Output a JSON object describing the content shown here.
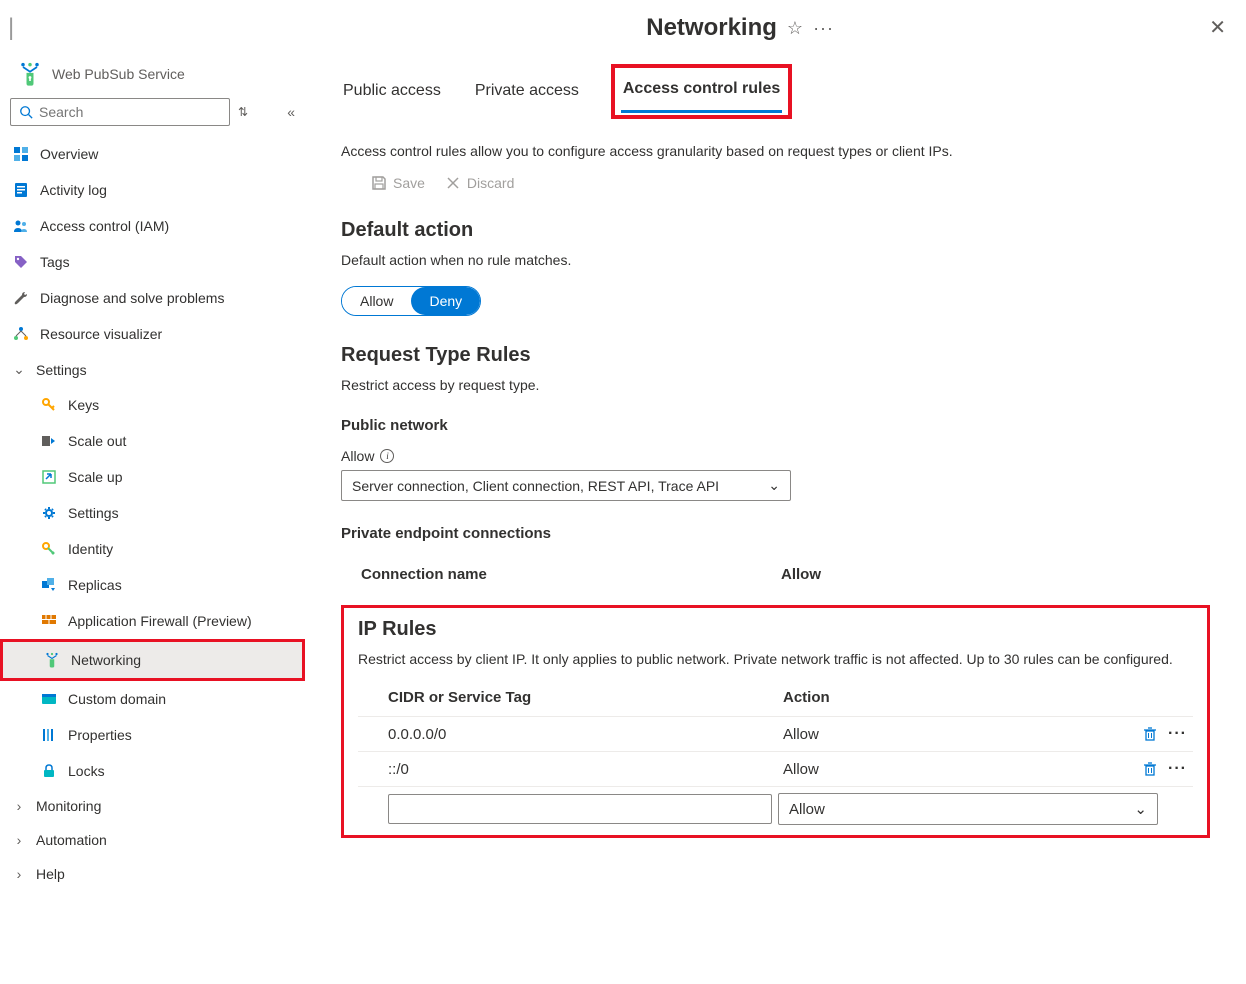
{
  "header": {
    "title": "Networking",
    "separator": "|"
  },
  "sidebar": {
    "service_name": "Web PubSub Service",
    "search_placeholder": "Search",
    "items": {
      "overview": "Overview",
      "activity": "Activity log",
      "iam": "Access control (IAM)",
      "tags": "Tags",
      "diagnose": "Diagnose and solve problems",
      "visualizer": "Resource visualizer",
      "settings": "Settings",
      "keys": "Keys",
      "scaleout": "Scale out",
      "scaleup": "Scale up",
      "settings_sub": "Settings",
      "identity": "Identity",
      "replicas": "Replicas",
      "firewall": "Application Firewall (Preview)",
      "networking": "Networking",
      "domain": "Custom domain",
      "properties": "Properties",
      "locks": "Locks",
      "monitoring": "Monitoring",
      "automation": "Automation",
      "help": "Help"
    }
  },
  "tabs": {
    "public": "Public access",
    "private": "Private access",
    "acr": "Access control rules"
  },
  "main": {
    "desc": "Access control rules allow you to configure access granularity based on request types or client IPs.",
    "save": "Save",
    "discard": "Discard",
    "default_action": {
      "heading": "Default action",
      "desc": "Default action when no rule matches.",
      "allow": "Allow",
      "deny": "Deny"
    },
    "request_rules": {
      "heading": "Request Type Rules",
      "desc": "Restrict access by request type.",
      "public_label": "Public network",
      "allow_label": "Allow",
      "dropdown_value": "Server connection, Client connection, REST API, Trace API",
      "private_label": "Private endpoint connections",
      "conn_name_col": "Connection name",
      "allow_col": "Allow"
    },
    "ip_rules": {
      "heading": "IP Rules",
      "desc": "Restrict access by client IP. It only applies to public network. Private network traffic is not affected. Up to 30 rules can be configured.",
      "cidr_col": "CIDR or Service Tag",
      "action_col": "Action",
      "rows": [
        {
          "cidr": "0.0.0.0/0",
          "action": "Allow"
        },
        {
          "cidr": "::/0",
          "action": "Allow"
        }
      ],
      "new_action": "Allow"
    }
  }
}
